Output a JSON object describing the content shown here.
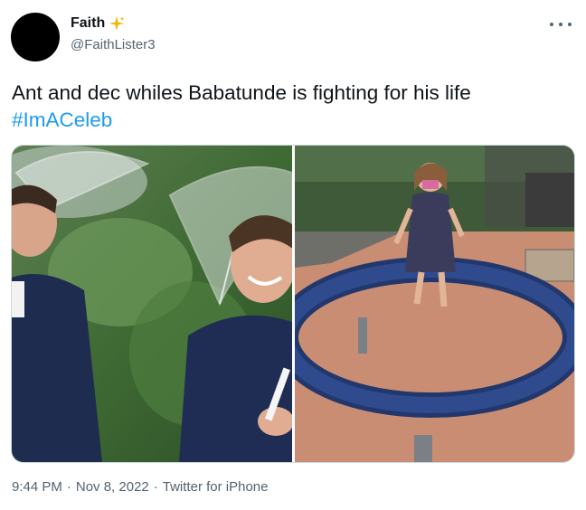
{
  "author": {
    "display_name": "Faith",
    "handle": "@FaithLister3",
    "badge_icon": "sparkles-icon",
    "avatar_color": "#000000"
  },
  "tweet": {
    "text": "Ant and dec whiles Babatunde is fighting for his life",
    "hashtag": "#ImACeleb"
  },
  "media": {
    "left_image": "two-presenters-under-umbrellas",
    "right_image": "child-on-playground-ring"
  },
  "meta": {
    "time": "9:44 PM",
    "separator": "·",
    "date": "Nov 8, 2022",
    "source": "Twitter for iPhone"
  },
  "colors": {
    "link": "#1d9bf0",
    "secondary_text": "#536471",
    "primary_text": "#0f1419",
    "border": "#cfd9de"
  }
}
